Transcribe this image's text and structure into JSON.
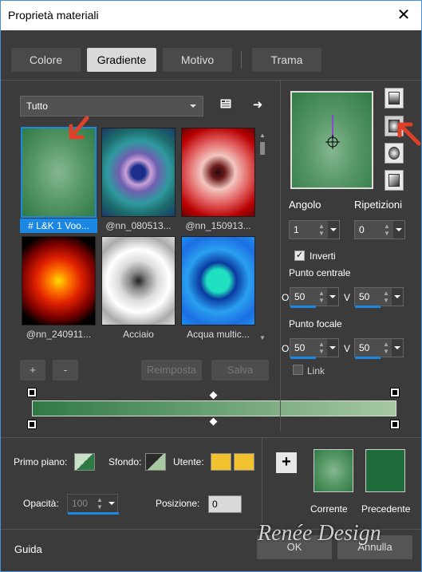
{
  "window": {
    "title": "Proprietà materiali",
    "close": "✕"
  },
  "tabs": [
    {
      "label": "Colore",
      "active": false
    },
    {
      "label": "Gradiente",
      "active": true
    },
    {
      "label": "Motivo",
      "active": false
    },
    {
      "label": "Trama",
      "active": false
    }
  ],
  "category": {
    "value": "Tutto"
  },
  "gallery": {
    "items": [
      {
        "caption": "# L&K 1 Voo...",
        "selected": true,
        "colors": [
          "#86b891",
          "#2f7a44"
        ]
      },
      {
        "caption": "@nn_080513...",
        "selected": false,
        "colors": [
          "#2c3e9a",
          "#c9a1d8"
        ]
      },
      {
        "caption": "@nn_150913...",
        "selected": false,
        "colors": [
          "#f3c6c0",
          "#8b0000"
        ]
      },
      {
        "caption": "@nn_240911...",
        "selected": false,
        "colors": [
          "#ffcc00",
          "#b30000"
        ]
      },
      {
        "caption": "Acciaio",
        "selected": false,
        "colors": [
          "#333333",
          "#ffffff"
        ]
      },
      {
        "caption": "Acqua multic...",
        "selected": false,
        "colors": [
          "#1fe0c0",
          "#1c6ee3"
        ]
      }
    ]
  },
  "buttons": {
    "add": "+",
    "remove": "-",
    "reset": "Reimposta",
    "save": "Salva",
    "ok": "OK",
    "cancel": "Annulla",
    "help": "Guida"
  },
  "gradient": {
    "start_color": "#2f7a44",
    "end_color": "#a6c9a0"
  },
  "angle": {
    "label": "Angolo",
    "value": "1"
  },
  "repeats": {
    "label": "Ripetizioni",
    "value": "0"
  },
  "invert": {
    "label": "Inverti",
    "checked": true
  },
  "center": {
    "label": "Punto centrale",
    "h_prefix": "O",
    "v_prefix": "V",
    "h_value": "50",
    "v_value": "50"
  },
  "focal": {
    "label": "Punto focale",
    "h_prefix": "O",
    "v_prefix": "V",
    "h_value": "50",
    "v_value": "50"
  },
  "link": {
    "label": "Link",
    "checked": false
  },
  "bottom": {
    "foreground_label": "Primo piano:",
    "background_label": "Sfondo:",
    "user_label": "Utente:",
    "user_colors": [
      "#f2c12e",
      "#f2c12e"
    ],
    "opacity_label": "Opacità:",
    "opacity_value": "100",
    "position_label": "Posizione:",
    "position_value": "0",
    "current_label": "Corrente",
    "previous_label": "Precedente",
    "previous_color": "#1f6b3a"
  },
  "watermark": "Renée Design"
}
